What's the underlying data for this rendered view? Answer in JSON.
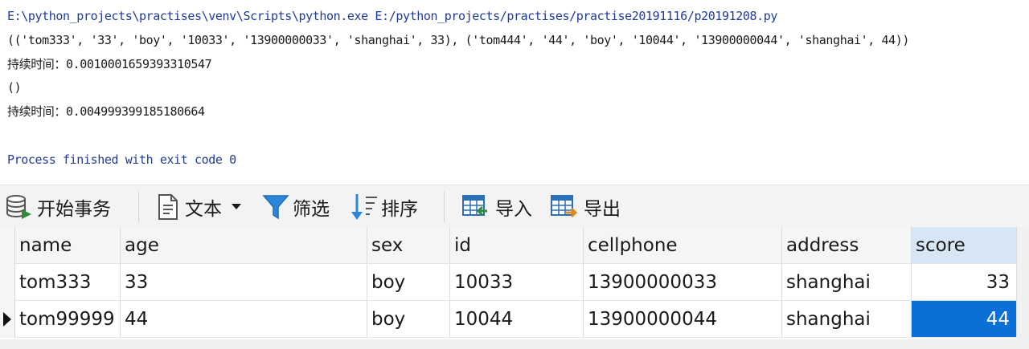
{
  "console": {
    "command": "E:\\python_projects\\practises\\venv\\Scripts\\python.exe E:/python_projects/practises/practise20191116/p20191208.py",
    "output1": "(('tom333', '33', 'boy', '10033', '13900000033', 'shanghai', 33), ('tom444', '44', 'boy', '10044', '13900000044', 'shanghai', 44))",
    "duration1": "持续时间：0.0010001659393310547",
    "output2": "()",
    "duration2": "持续时间：0.004999399185180664",
    "finished": "Process finished with exit code 0"
  },
  "toolbar": {
    "begin_transaction": "开始事务",
    "text": "文本",
    "filter": "筛选",
    "sort": "排序",
    "import": "导入",
    "export": "导出"
  },
  "grid": {
    "columns": [
      "name",
      "age",
      "sex",
      "id",
      "cellphone",
      "address",
      "score"
    ],
    "rows": [
      [
        "tom333",
        "33",
        "boy",
        "10033",
        "13900000033",
        "shanghai",
        "33"
      ],
      [
        "tom99999",
        "44",
        "boy",
        "10044",
        "13900000044",
        "shanghai",
        "44"
      ]
    ]
  },
  "colors": {
    "selected_cell": "#0a6fd6",
    "active_header": "#d6e6f5",
    "console_command": "#1f3a9a"
  }
}
